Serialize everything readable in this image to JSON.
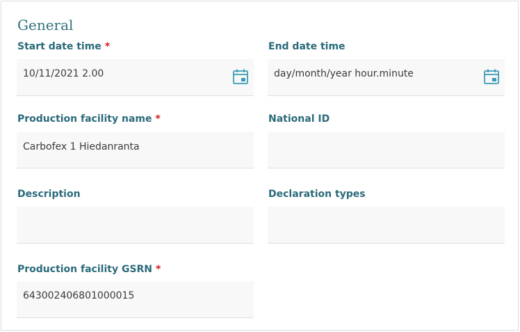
{
  "section": {
    "title": "General"
  },
  "fields": {
    "start": {
      "label": "Start date time",
      "required_mark": "*",
      "value": "10/11/2021 2.00",
      "icon": "calendar-icon"
    },
    "end": {
      "label": "End date time",
      "placeholder": "day/month/year hour.minute",
      "icon": "calendar-icon"
    },
    "facility_name": {
      "label": "Production facility name",
      "required_mark": "*",
      "value": "Carbofex 1 Hiedanranta"
    },
    "national_id": {
      "label": "National ID",
      "value": ""
    },
    "description": {
      "label": "Description",
      "value": ""
    },
    "declaration_types": {
      "label": "Declaration types",
      "value": ""
    },
    "gsrn": {
      "label": "Production facility GSRN",
      "required_mark": "*",
      "value": "643002406801000015"
    }
  },
  "colors": {
    "label": "#2a6a7a",
    "required": "#d11a1a",
    "icon": "#3a9bb5",
    "field_bg": "#f8f8f8"
  }
}
